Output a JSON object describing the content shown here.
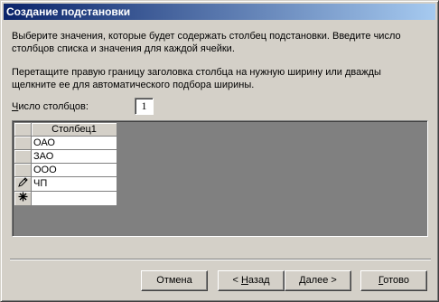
{
  "window": {
    "title": "Создание подстановки"
  },
  "instructions": {
    "paragraph1_line1": "Выберите значения, которые будет содержать столбец подстановки. Введите число",
    "paragraph1_line2": "столбцов списка и значения для каждой ячейки.",
    "paragraph2_line1": "Перетащите правую границу заголовка столбца на нужную ширину или дважды",
    "paragraph2_line2": "щелкните ее для автоматического подбора ширины."
  },
  "columns_count": {
    "label_accel": "Ч",
    "label_rest": "исло столбцов:",
    "value": "1"
  },
  "grid": {
    "column_header": "Столбец1",
    "rows": [
      {
        "value": "ОАО",
        "selector": ""
      },
      {
        "value": "ЗАО",
        "selector": ""
      },
      {
        "value": "ООО",
        "selector": ""
      },
      {
        "value": "ЧП",
        "selector": "pencil-icon"
      },
      {
        "value": "",
        "selector": "new-row-icon"
      }
    ]
  },
  "buttons": {
    "cancel": "Отмена",
    "back_prefix": "< ",
    "back_accel": "Н",
    "back_rest": "азад",
    "next_accel": "Д",
    "next_rest": "алее >",
    "finish_accel": "Г",
    "finish_rest": "отово"
  }
}
